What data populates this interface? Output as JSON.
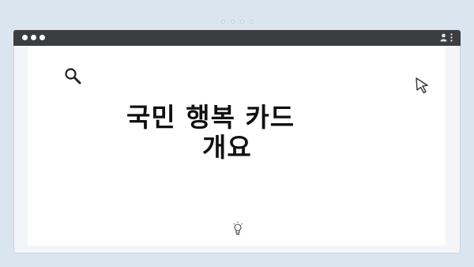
{
  "window": {
    "controls": [
      "close",
      "minimize",
      "maximize"
    ],
    "toolbar_icons": [
      "user-icon",
      "more-vertical-icon"
    ]
  },
  "pager": {
    "dots": 4
  },
  "content": {
    "title_line1": "국민 행복 카드",
    "title_line2": "개요",
    "icons": [
      "search-icon",
      "cursor-arrow-icon",
      "lightbulb-icon"
    ]
  },
  "colors": {
    "background": "#dbe5ef",
    "titlebar": "#3b3d40",
    "content": "#ffffff",
    "text": "#111111"
  }
}
